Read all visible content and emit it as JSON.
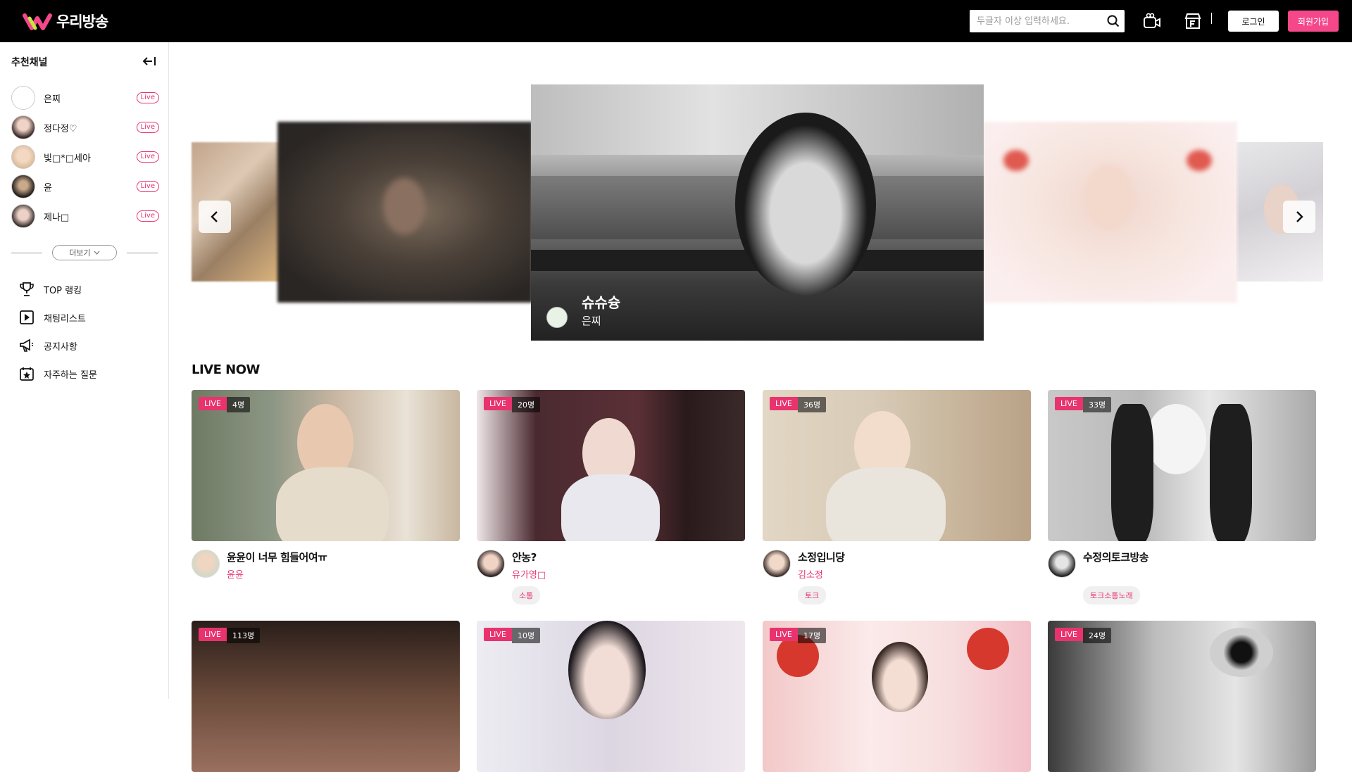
{
  "header": {
    "logo_text": "우리방송",
    "search_placeholder": "두글자 이상 입력하세요.",
    "login_label": "로그인",
    "join_label": "회원가입",
    "separator": "|",
    "icons": [
      "search-icon",
      "broadcast-icon",
      "store-icon"
    ],
    "colors": {
      "bg": "#000000",
      "accent": "#f5488b"
    }
  },
  "sidebar": {
    "title": "추천채널",
    "channels": [
      {
        "name": "은찌",
        "badge": "Live"
      },
      {
        "name": "정다정♡",
        "badge": "Live"
      },
      {
        "name": "빛□*□세아",
        "badge": "Live"
      },
      {
        "name": "윤",
        "badge": "Live"
      },
      {
        "name": "제나□",
        "badge": "Live"
      }
    ],
    "more_label": "더보기",
    "menu": [
      {
        "label": "TOP 랭킹",
        "icon": "trophy-icon"
      },
      {
        "label": "채팅리스트",
        "icon": "play-icon"
      },
      {
        "label": "공지사항",
        "icon": "megaphone-icon"
      },
      {
        "label": "자주하는 질문",
        "icon": "calendar-star-icon"
      }
    ]
  },
  "carousel": {
    "featured": {
      "title": "슈슈슝",
      "streamer": "은찌"
    }
  },
  "live_now": {
    "title": "LIVE NOW",
    "live_label": "LIVE",
    "cards": [
      {
        "viewers": "4명",
        "title": "윤윤이 너무 힘들어여ㅠ",
        "streamer": "윤윤",
        "tag": ""
      },
      {
        "viewers": "20명",
        "title": "안농?",
        "streamer": "유가영□",
        "tag": "소통"
      },
      {
        "viewers": "36명",
        "title": "소정입니당",
        "streamer": "김소정",
        "tag": "토크"
      },
      {
        "viewers": "33명",
        "title": "수정의토크방송",
        "streamer": "",
        "tag": "토크소통노래"
      },
      {
        "viewers": "113명"
      },
      {
        "viewers": "10명"
      },
      {
        "viewers": "17명"
      },
      {
        "viewers": "24명"
      }
    ]
  }
}
